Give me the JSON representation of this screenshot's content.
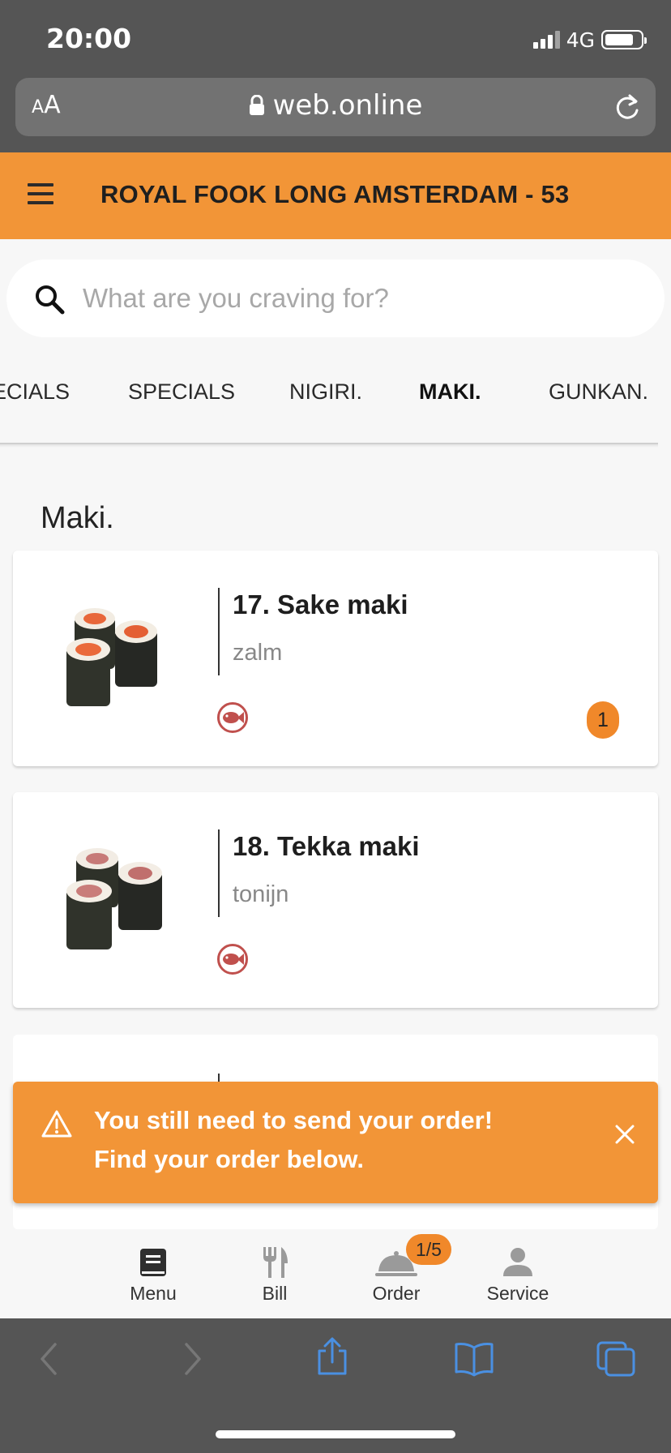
{
  "status_bar": {
    "time": "20:00",
    "network": "4G"
  },
  "browser": {
    "aa_small": "A",
    "aa_big": "A",
    "url": "web.online"
  },
  "header": {
    "title": "ROYAL FOOK LONG AMSTERDAM - 53"
  },
  "search": {
    "placeholder": "What are you craving for?"
  },
  "tabs": [
    {
      "label": "ECIALS"
    },
    {
      "label": "SPECIALS"
    },
    {
      "label": "NIGIRI."
    },
    {
      "label": "MAKI."
    },
    {
      "label": "GUNKAN."
    }
  ],
  "active_tab": "MAKI.",
  "section": {
    "title": "Maki."
  },
  "items": [
    {
      "name": "17. Sake maki",
      "description": "zalm",
      "quantity": "1",
      "allergen_icon": "fish-icon"
    },
    {
      "name": "18. Tekka maki",
      "description": "tonijn",
      "allergen_icon": "fish-icon"
    }
  ],
  "toast": {
    "line1": "You still need to send your order!",
    "line2": "Find your order below."
  },
  "bottom_nav": [
    {
      "label": "Menu",
      "icon": "book-icon"
    },
    {
      "label": "Bill",
      "icon": "cutlery-icon"
    },
    {
      "label": "Order",
      "icon": "cloche-icon",
      "badge": "1/5"
    },
    {
      "label": "Service",
      "icon": "person-icon"
    }
  ],
  "colors": {
    "brand_orange": "#f29537",
    "badge_orange": "#f0882a",
    "allergen_red": "#c0504d",
    "browser_gray": "#555555",
    "ios_blue": "#4a90e2"
  }
}
